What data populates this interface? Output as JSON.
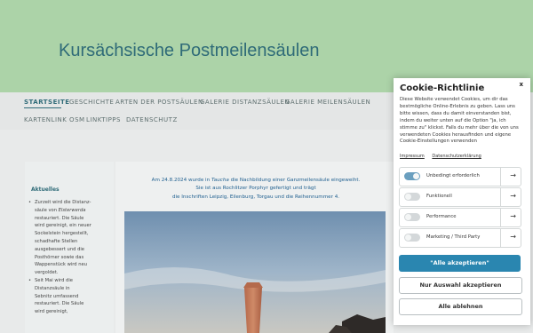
{
  "site": {
    "title": "Kursächsische Postmeilensäulen"
  },
  "nav": {
    "items": [
      {
        "label": "STARTSEITE",
        "active": true
      },
      {
        "label": "GESCHICHTE"
      },
      {
        "label": "ARTEN DER POSTSÄULEN"
      },
      {
        "label": "GALERIE DISTANZSÄULEN"
      },
      {
        "label": "GALERIE MEILENSÄULEN"
      },
      {
        "label": "KARTENLINK OSM"
      },
      {
        "label": "LINKTIPPS"
      },
      {
        "label": "DATENSCHUTZ"
      }
    ]
  },
  "sidebar": {
    "title": "Aktuelles",
    "items": [
      [
        "Zurzeit wird die Distanz-",
        "säule von ",
        "Elsterwerda",
        "",
        "restauriert. Die Säule",
        "wird gereinigt, ein neuer",
        "Sockelstein hergestellt,",
        "schadhafte Stellen",
        "ausgebessert und die",
        "Posthörner sowie das",
        "Wappenstück wird neu",
        "vergoldet."
      ],
      [
        "Seit Mai wird die",
        "Distanzsäule in",
        "Sebnitz umfassend",
        "restauriert. Die Säule",
        "wird gereinigt,"
      ]
    ]
  },
  "main": {
    "intro": {
      "line1_a": "Am 24.8.2024 wurde in ",
      "line1_place": "Taucha",
      "line1_b": " die Nachbildung einer Ganzmeilensäule eingeweiht.",
      "line2": "Sie ist aus Rochlitzer Porphyr gefertigt und trägt",
      "line3": "die Inschriften Leipzig, Eilenburg, Torgau und die Reihennummer 4."
    }
  },
  "cookie": {
    "title": "Cookie-Richtlinie",
    "close": "x",
    "text": "Diese Website verwendet Cookies, um dir das bestmögliche Online-Erlebnis zu geben. Lass uns bitte wissen, dass du damit einverstanden bist, indem du weiter unten auf die Option \"ja, ich stimme zu\" klickst. Falls du mehr über die von uns verwendeten Cookies herausfinden und eigene Cookie-Einstellungen verwenden",
    "link_impressum": "Impressum",
    "link_datenschutz": "Datenschutzerklärung",
    "categories": [
      {
        "label": "Unbedingt erforderlich",
        "enabled": true
      },
      {
        "label": "Funktionell",
        "enabled": false
      },
      {
        "label": "Performance",
        "enabled": false
      },
      {
        "label": "Marketing / Third Party",
        "enabled": false
      }
    ],
    "arrow": "→",
    "accept_all": "\"Alle akzeptieren\"",
    "accept_selection": "Nur Auswahl akzeptieren",
    "reject_all": "Alle ablehnen"
  }
}
